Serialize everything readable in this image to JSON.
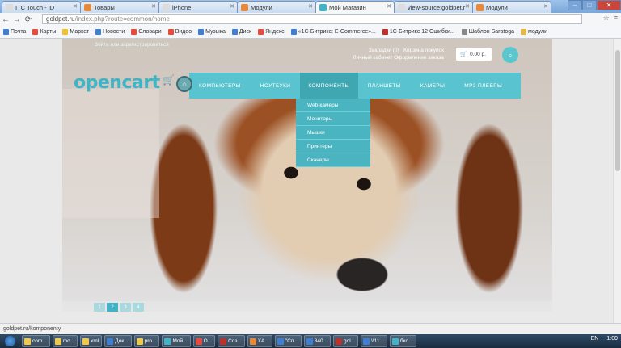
{
  "browser": {
    "tabs": [
      {
        "title": "ITC Touch - ID",
        "color": "#dcdcdc",
        "active": false
      },
      {
        "title": "Товары",
        "color": "#e8893a",
        "active": false
      },
      {
        "title": "iPhone",
        "color": "#dcdcdc",
        "active": false
      },
      {
        "title": "Модули",
        "color": "#e8893a",
        "active": false
      },
      {
        "title": "Мой Магазин",
        "color": "#3fb4c6",
        "active": true
      },
      {
        "title": "view-source:goldpet.r",
        "color": "#dcdcdc",
        "active": false
      },
      {
        "title": "Модули",
        "color": "#e8893a",
        "active": false
      }
    ],
    "window_buttons": {
      "minimize": "–",
      "maximize": "□",
      "close": "✕"
    },
    "nav": {
      "back": "←",
      "forward": "→",
      "reload": "⟳"
    },
    "url_host": "goldpet.ru",
    "url_path": "/index.php?route=common/home",
    "star_icon": "☆",
    "menu_icon": "≡",
    "bookmarks": [
      {
        "label": "Почта",
        "color": "#3e7fd6"
      },
      {
        "label": "Карты",
        "color": "#e84b3c"
      },
      {
        "label": "Маркет",
        "color": "#f3c12b"
      },
      {
        "label": "Новости",
        "color": "#3e7fd6"
      },
      {
        "label": "Словари",
        "color": "#e84b3c"
      },
      {
        "label": "Видео",
        "color": "#e84b3c"
      },
      {
        "label": "Музыка",
        "color": "#3e7fd6"
      },
      {
        "label": "Диск",
        "color": "#3e7fd6"
      },
      {
        "label": "Яндекс",
        "color": "#e84b3c"
      },
      {
        "label": "«1С-Битрикс: E-Commerce»...",
        "color": "#3e7fd6"
      },
      {
        "label": "1С-Битрикс 12 Ошибки...",
        "color": "#c0302a"
      },
      {
        "label": "Шаблон Saratoga",
        "color": "#888888"
      },
      {
        "label": "модули",
        "color": "#e6b93c"
      }
    ]
  },
  "site": {
    "header_links": "Войти или зарегистрироваться",
    "wishlist": "Закладки (0)",
    "cart_link": "Корзина покупок",
    "account_checkout": "Личный кабинет Оформление заказа",
    "cart_total": "0.00 р.",
    "cart_icon": "🛒",
    "search_icon": "⌕",
    "logo_text": "opencart",
    "logo_cart_icon": "🛒",
    "home_icon": "⌂",
    "menu": [
      {
        "label": "КОМПЬЮТЕРЫ",
        "active": false
      },
      {
        "label": "НОУТБУКИ",
        "active": false
      },
      {
        "label": "КОМПОНЕНТЫ",
        "active": true
      },
      {
        "label": "ПЛАНШЕТЫ",
        "active": false
      },
      {
        "label": "КАМЕРЫ",
        "active": false
      },
      {
        "label": "MP3 ПЛЕЕРЫ",
        "active": false
      }
    ],
    "dropdown": [
      "Web-камеры",
      "Мониторы",
      "Мышки",
      "Принтеры",
      "Сканеры"
    ],
    "pager": [
      "1",
      "2",
      "3",
      "4"
    ],
    "pager_current": "2"
  },
  "status_url": "goldpet.ru/komponenty",
  "taskbar": {
    "tasks": [
      {
        "label": "com...",
        "color": "#f0c84a"
      },
      {
        "label": "mo...",
        "color": "#f0c84a"
      },
      {
        "label": "xml",
        "color": "#f0c84a"
      },
      {
        "label": "Док...",
        "color": "#3e7fd6"
      },
      {
        "label": "pro...",
        "color": "#f0c84a"
      },
      {
        "label": "Мой...",
        "color": "#3fb4c6"
      },
      {
        "label": "О...",
        "color": "#e84b3c"
      },
      {
        "label": "Соз...",
        "color": "#c0302a"
      },
      {
        "label": "ХА...",
        "color": "#e8893a"
      },
      {
        "label": "\"Сп...",
        "color": "#3e7fd6"
      },
      {
        "label": "340...",
        "color": "#3e7fd6"
      },
      {
        "label": "gol...",
        "color": "#c0302a"
      },
      {
        "label": "\\\\11...",
        "color": "#3e7fd6"
      },
      {
        "label": "бко...",
        "color": "#3fb4c6"
      }
    ],
    "lang": "EN",
    "time": "1:09"
  }
}
